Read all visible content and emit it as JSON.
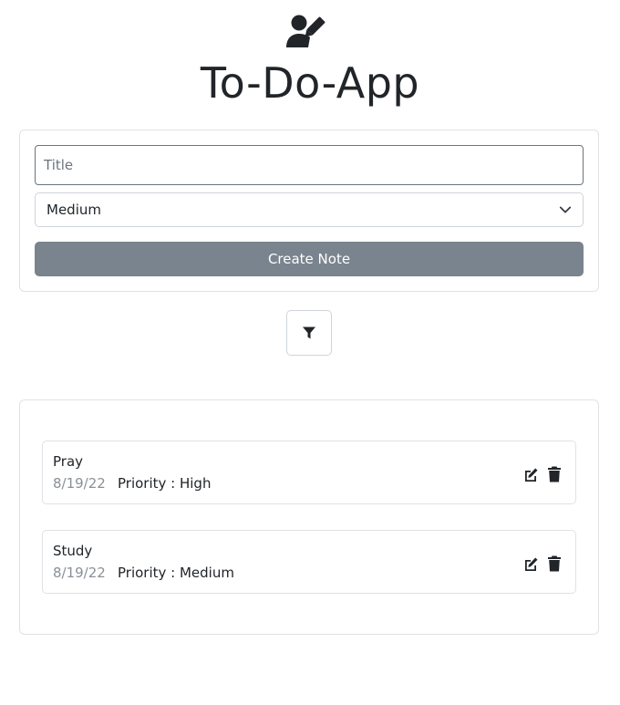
{
  "header": {
    "icon": "user-edit-icon",
    "title": "To-Do-App"
  },
  "form": {
    "title_placeholder": "Title",
    "title_value": "",
    "priority_selected": "Medium",
    "create_label": "Create Note"
  },
  "filter": {
    "icon": "filter-icon"
  },
  "notes": [
    {
      "title": "Pray",
      "date": "8/19/22",
      "priority_text": "Priority : High"
    },
    {
      "title": "Study",
      "date": "8/19/22",
      "priority_text": "Priority : Medium"
    }
  ],
  "colors": {
    "create_button": "#7a848e",
    "text": "#212529",
    "muted": "#8a9098",
    "border": "#dee2e6"
  }
}
